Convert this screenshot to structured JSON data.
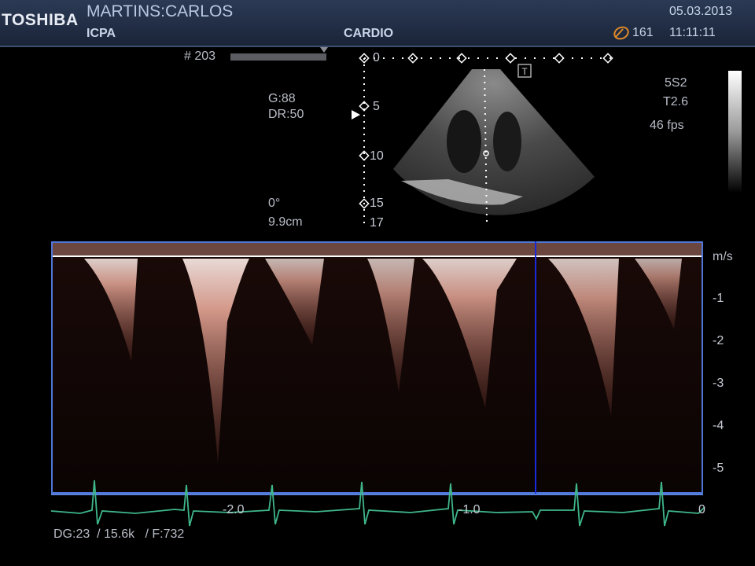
{
  "header": {
    "brand": "TOSHIBA",
    "patient_name": "MARTINS:CARLOS",
    "institution": "ICPA",
    "exam_preset": "CARDIO",
    "date": "05.03.2013",
    "time": "11:11:11",
    "ti_value": "161"
  },
  "image_params": {
    "frame_no": "# 203",
    "gain": "G:88",
    "dynamic_range": "DR:50",
    "angle": "0°",
    "depth": "9.9cm",
    "probe": "5S2",
    "tissue_mode": "T2.6",
    "frame_rate": "46 fps",
    "t_marker": "T"
  },
  "depth_scale": [
    "0",
    "5",
    "10",
    "15",
    "17"
  ],
  "doppler": {
    "unit": "m/s",
    "velocity_ticks": [
      "-1",
      "-2",
      "-3",
      "-4",
      "-5"
    ],
    "time_ticks": [
      "-2.0",
      "-1.0",
      "0"
    ],
    "footer": "DG:23  / 15.6k   / F:732"
  },
  "colors": {
    "header_bg": "#24324c",
    "accent_blue": "#4f77d8",
    "cursor_blue": "#1a2ad8",
    "ecg_green": "#3fb68a",
    "doppler_hue": "#e8a898"
  }
}
